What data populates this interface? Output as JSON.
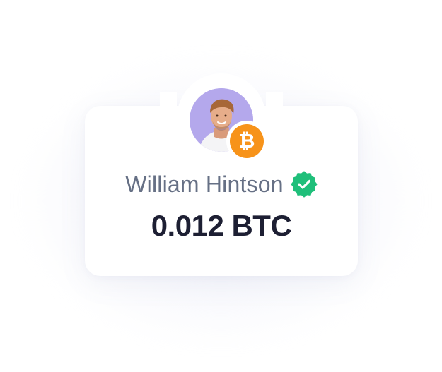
{
  "profile_card": {
    "name": "William Hintson",
    "amount": "0.012 BTC",
    "avatar_icon": "person-avatar-icon",
    "coin_icon": "bitcoin-icon",
    "verified_icon": "verified-badge-icon"
  },
  "colors": {
    "avatar_background": "#b4a8ec",
    "bitcoin_orange": "#f7931a",
    "verified_green": "#1fbf7a",
    "name_text": "#667085",
    "amount_text": "#1d1f33",
    "card_background": "#ffffff"
  }
}
